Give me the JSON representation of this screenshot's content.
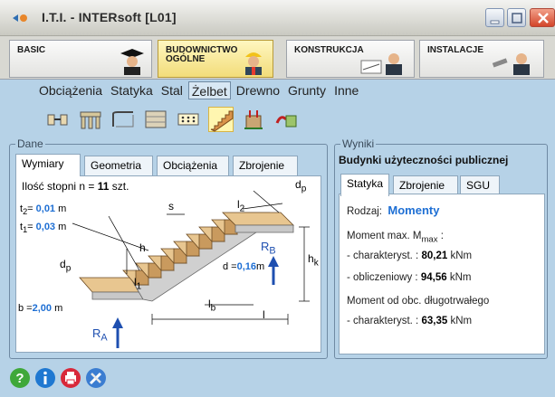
{
  "window": {
    "title": "I.T.I. - INTERsoft [L01]"
  },
  "modules": [
    {
      "label": "BASIC"
    },
    {
      "label_line1": "BUDOWNICTWO",
      "label_line2": "OGÓLNE"
    },
    {
      "label": "KONSTRUKCJA"
    },
    {
      "label": "INSTALACJE"
    }
  ],
  "menu": [
    "Obciążenia",
    "Statyka",
    "Stal",
    "Żelbet",
    "Drewno",
    "Grunty",
    "Inne"
  ],
  "menu_active": "Żelbet",
  "toolbar_icons": [
    "beam-icon",
    "frame-icon",
    "slab-icon",
    "wall-icon",
    "grid-icon",
    "stairs-icon",
    "column-icon",
    "misc-icon"
  ],
  "dane": {
    "group_title": "Dane",
    "tabs": [
      "Wymiary",
      "Geometria",
      "Obciążenia",
      "Zbrojenie"
    ],
    "active_tab": "Wymiary",
    "steps_label": "Ilość stopni n  =",
    "steps_value": "11",
    "steps_unit": "szt.",
    "t2_label": "t",
    "t2_sub": "2",
    "t2_value": "0,01",
    "t1_sub": "1",
    "t1_value": "0,03",
    "unit_m": "m",
    "b_label": "b =",
    "b_value": "2,00",
    "d_label": "d =",
    "d_value": "0,16",
    "dim_dp": "d",
    "dim_dp_sub": "p",
    "dim_s": "s",
    "dim_l": "l",
    "dim_l2_sub": "2",
    "dim_l1_sub": "1",
    "dim_lb_sub": "b",
    "dim_h": "h",
    "dim_hk_sub": "k",
    "dim_RA": "R",
    "dim_RA_sub": "A",
    "dim_RB": "R",
    "dim_RB_sub": "B"
  },
  "wyniki": {
    "group_title": "Wyniki",
    "subtitle": "Budynki użyteczności publicznej",
    "tabs": [
      "Statyka",
      "Zbrojenie",
      "SGU"
    ],
    "active_tab": "Statyka",
    "rodzaj_label": "Rodzaj:",
    "rodzaj_value": "Momenty",
    "moment_max_label": "Moment max. M",
    "moment_max_sub": "max",
    "moment_max_colon": " :",
    "char_label": "- charakteryst. :",
    "char_value": "80,21",
    "oblicz_label": "- obliczeniowy :",
    "oblicz_value": "94,56",
    "unit_knm": "kNm",
    "dlugo_label": "Moment od obc. długotrwałego",
    "char2_label": "- charakteryst. :",
    "char2_value": "63,35"
  },
  "bottom_icons": [
    "help-icon",
    "info-icon",
    "print-icon",
    "tools-icon"
  ]
}
